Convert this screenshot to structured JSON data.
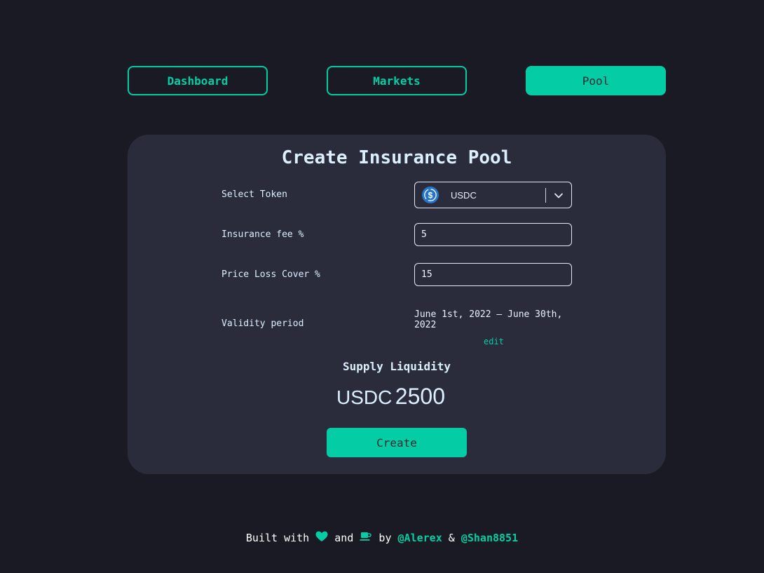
{
  "nav": {
    "dashboard_label": "Dashboard",
    "markets_label": "Markets",
    "pool_label": "Pool"
  },
  "card": {
    "title": "Create Insurance Pool",
    "select_token_label": "Select Token",
    "selected_token": "USDC",
    "insurance_fee_label": "Insurance fee %",
    "insurance_fee_value": "5",
    "price_loss_label": "Price Loss Cover %",
    "price_loss_value": "15",
    "validity_label": "Validity period",
    "validity_value": "June 1st, 2022 – June 30th, 2022",
    "edit_label": "edit",
    "supply_title": "Supply Liquidity",
    "supply_token": "USDC",
    "supply_amount": "2500",
    "create_label": "Create"
  },
  "footer": {
    "built_with": "Built with",
    "and": "and",
    "by": "by",
    "author1": "@Alerex",
    "amp": "&",
    "author2": "@Shan8851"
  },
  "colors": {
    "accent": "#04cda5",
    "background": "#191a23",
    "card": "#2a2c3c",
    "usdc": "#2775ca"
  },
  "icons": {
    "token": "usdc-icon",
    "dropdown": "chevron-down-icon",
    "heart": "heart-icon",
    "coffee": "coffee-icon"
  }
}
